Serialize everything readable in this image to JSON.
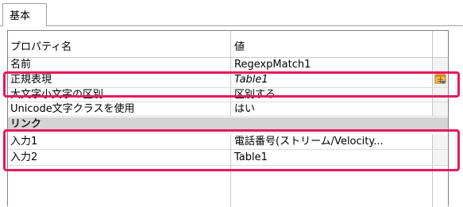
{
  "tab": {
    "label": "基本"
  },
  "grid": {
    "header": {
      "name": "プロパティ名",
      "value": "値"
    },
    "rows": [
      {
        "name": "名前",
        "value": "RegexpMatch1"
      },
      {
        "name": "正規表現",
        "value": "Table1"
      },
      {
        "name": "大文字小文字の区別",
        "value": "区別する"
      },
      {
        "name": "Unicode文字クラスを使用",
        "value": "はい"
      }
    ],
    "category": {
      "name": "リンク"
    },
    "link_rows": [
      {
        "name": "入力1",
        "value": "電話番号(ストリーム/Velocity..."
      },
      {
        "name": "入力2",
        "value": "Table1"
      }
    ]
  },
  "colors": {
    "highlight": "#e8185a",
    "category_bg": "#d4d4d4",
    "button_icon": "#e8a33a"
  },
  "icons": {
    "regex_editor": "table-editor-icon"
  }
}
